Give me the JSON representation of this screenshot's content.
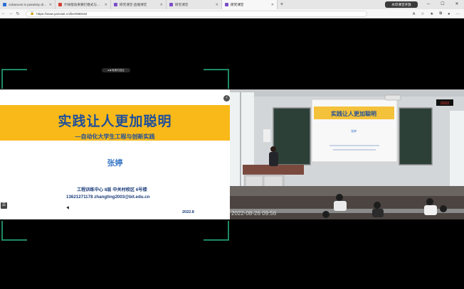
{
  "browser": {
    "tabs": [
      {
        "title": "Advances in passivity driven • Fi",
        "active": false,
        "color": "#2b6fd6"
      },
      {
        "title": "什样能动来赛打模式与开发温言",
        "active": false,
        "color": "#d23f31"
      },
      {
        "title": "研究课堂-直播课堂",
        "active": false,
        "color": "#7a4dc9"
      },
      {
        "title": "研究课堂",
        "active": false,
        "color": "#7a4dc9"
      },
      {
        "title": "研究课堂",
        "active": true,
        "color": "#7a4dc9"
      }
    ],
    "url": "https://www.yanxiuit.cn/live/689162",
    "overlay_caption": "水印课堂开放"
  },
  "player": {
    "mini_toolbar": "◂ ■ 转换内容区",
    "side_button": "☰",
    "split_button": "‹"
  },
  "slide": {
    "title": "实践让人更加聪明",
    "subtitle": "—自动化大学生工程与创新实践",
    "presenter": "张婷",
    "address": "工程训练中心  8层   中关村校区  6号楼",
    "contact": "13621271178    zhangting2003@bit.edu.cn",
    "date": "2022.8"
  },
  "camera": {
    "timestamp": "2022-08-26  09:56",
    "projected_title": "实践让人更加聪明",
    "projected_presenter": "张婷",
    "clock_display": "2022"
  },
  "colors": {
    "accent": "#f8b919",
    "title_blue": "#1f4f9a",
    "frame_green": "#1f8a63"
  }
}
